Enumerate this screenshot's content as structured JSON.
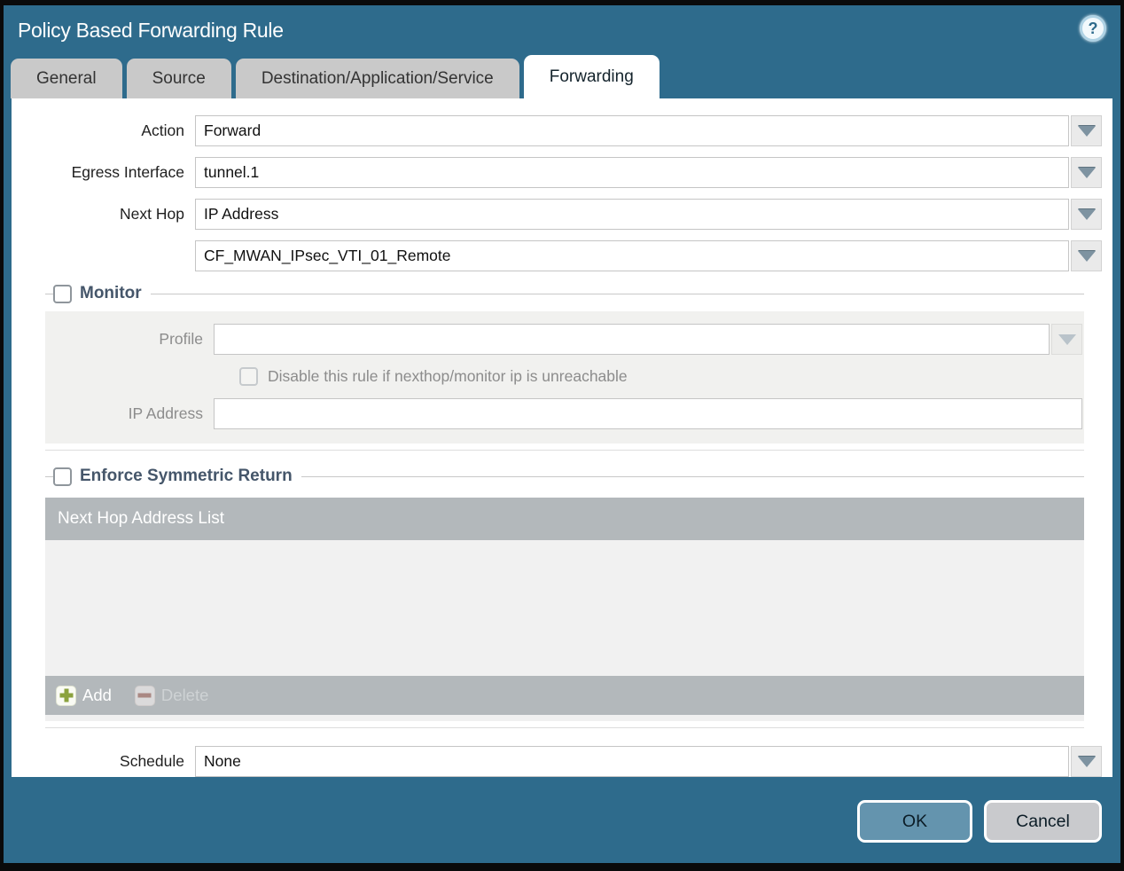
{
  "title": "Policy Based Forwarding Rule",
  "icons": {
    "help": "?"
  },
  "tabs": [
    {
      "label": "General",
      "active": false
    },
    {
      "label": "Source",
      "active": false
    },
    {
      "label": "Destination/Application/Service",
      "active": false
    },
    {
      "label": "Forwarding",
      "active": true
    }
  ],
  "form": {
    "action": {
      "label": "Action",
      "value": "Forward"
    },
    "egress_interface": {
      "label": "Egress Interface",
      "value": "tunnel.1"
    },
    "next_hop": {
      "label": "Next Hop",
      "value": "IP Address"
    },
    "next_hop_address": {
      "value": "CF_MWAN_IPsec_VTI_01_Remote"
    },
    "schedule": {
      "label": "Schedule",
      "value": "None"
    }
  },
  "monitor": {
    "title": "Monitor",
    "checked": false,
    "profile": {
      "label": "Profile",
      "value": ""
    },
    "disable_rule_checkbox": {
      "label": "Disable this rule if nexthop/monitor ip is unreachable",
      "checked": false
    },
    "ip_address": {
      "label": "IP Address",
      "value": ""
    }
  },
  "enforce_symmetric_return": {
    "title": "Enforce Symmetric Return",
    "checked": false,
    "table": {
      "header": "Next Hop Address List",
      "rows": []
    },
    "add_label": "Add",
    "delete_label": "Delete"
  },
  "footer": {
    "ok_label": "OK",
    "cancel_label": "Cancel"
  },
  "colors": {
    "accent_teal": "#2e6b8c",
    "tab_inactive": "#c9c9c9",
    "panel_gray": "#f1f1ef",
    "field_cream": "#f6efda",
    "table_gray": "#b3b8bb",
    "add_green": "#8ba23e",
    "delete_red": "#a5695e",
    "ok_blue": "#6494ae"
  }
}
